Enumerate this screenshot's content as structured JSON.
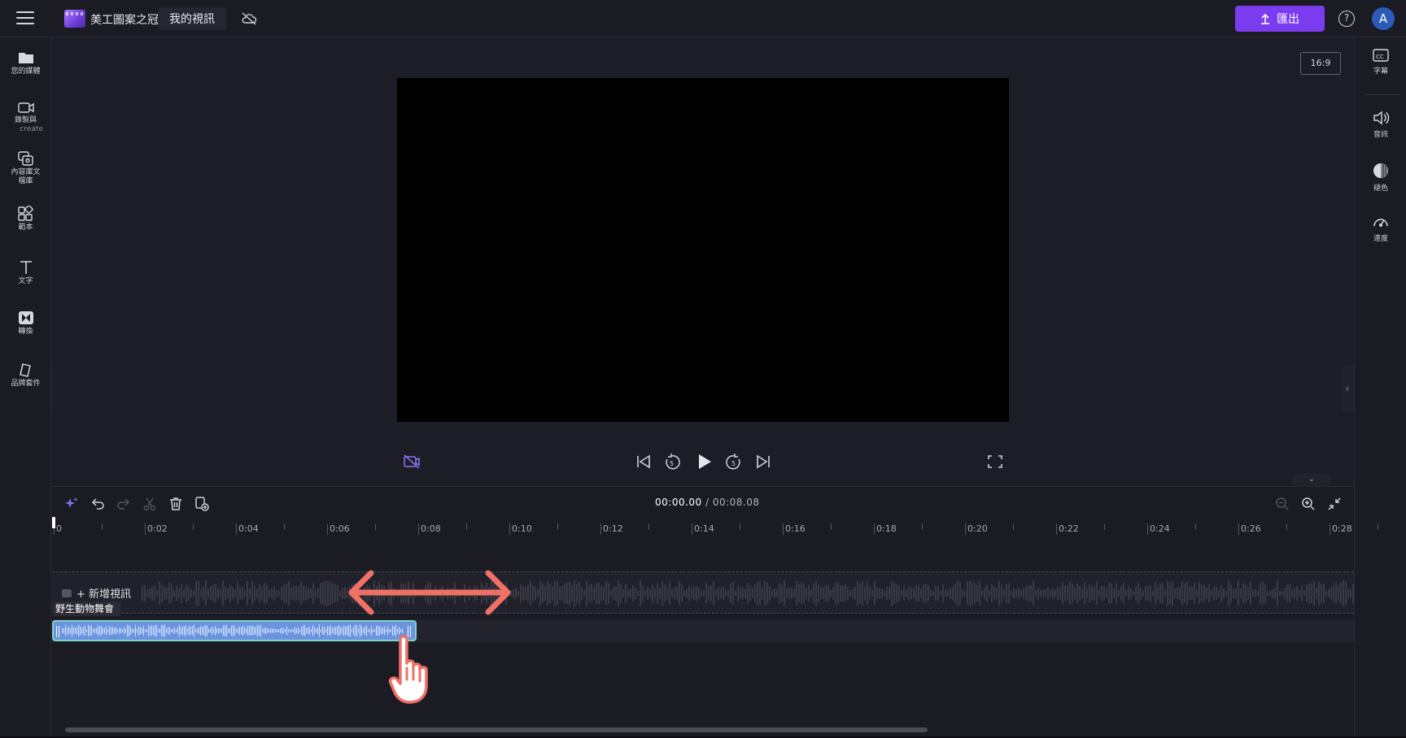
{
  "topbar": {
    "project_title": "美工圖案之冠軍",
    "project_name": "我的視訊",
    "export_label": "匯出",
    "help_glyph": "?",
    "avatar_initial": "A"
  },
  "leftbar": {
    "items": [
      {
        "label": "您的媒體"
      },
      {
        "label": "錄製與",
        "sublabel": "create"
      },
      {
        "label": "內容庫文",
        "label2": "檔庫"
      },
      {
        "label": "範本"
      },
      {
        "label": "文字"
      },
      {
        "label": "轉換"
      },
      {
        "label": "品牌套件"
      }
    ]
  },
  "rightbar": {
    "items": [
      {
        "label": "字幕"
      },
      {
        "label": "音訊"
      },
      {
        "label": "褪色"
      },
      {
        "label": "速度"
      }
    ]
  },
  "preview": {
    "aspect_ratio": "16:9"
  },
  "timeline": {
    "current_time": "00:00.00",
    "total_time": "/ 00:08.08",
    "ticks": [
      "0",
      "0:02",
      "0:04",
      "0:06",
      "0:08",
      "0:10",
      "0:12",
      "0:14",
      "0:16",
      "0:18",
      "0:20",
      "0:22",
      "0:24",
      "0:26",
      "0:28"
    ],
    "add_video_label": "+ 新增視訊",
    "audio_clip_label": "野生動物舞會"
  },
  "colors": {
    "accent": "#7b3cf0",
    "audio_clip": "#6a93e0",
    "audio_clip_border": "#7fd3c6",
    "arrow": "#f07066"
  }
}
